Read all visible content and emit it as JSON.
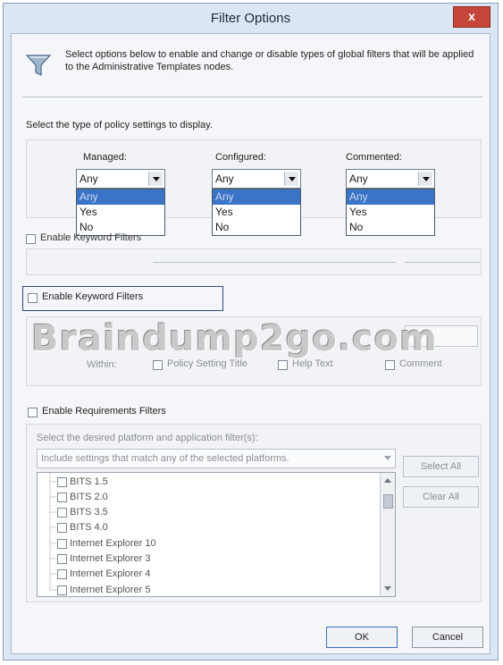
{
  "window": {
    "title": "Filter Options",
    "close_label": "x"
  },
  "description": "Select options below to enable and change or disable types of global filters that will be applied to the Administrative Templates nodes.",
  "policy_type": {
    "heading": "Select the type of policy settings to display.",
    "managed": {
      "label": "Managed:",
      "value": "Any",
      "options": [
        "Any",
        "Yes",
        "No"
      ]
    },
    "configured": {
      "label": "Configured:",
      "value": "Any",
      "options": [
        "Any",
        "Yes",
        "No"
      ]
    },
    "commented": {
      "label": "Commented:",
      "value": "Any",
      "options": [
        "Any",
        "Yes",
        "No"
      ]
    }
  },
  "obscured_checkbox_label": "Enable Keyword Filters",
  "keyword": {
    "checkbox_label": "Enable Keyword Filters",
    "within_label": "Within:",
    "options": [
      "Policy Setting Title",
      "Help Text",
      "Comment"
    ]
  },
  "watermark": "Braindump2go.com",
  "requirements": {
    "checkbox_label": "Enable Requirements Filters",
    "platform_label": "Select the desired platform and application filter(s):",
    "match_value": "Include settings that match any of the selected platforms.",
    "select_all": "Select All",
    "clear_all": "Clear All",
    "platforms": [
      "BITS 1.5",
      "BITS 2.0",
      "BITS 3.5",
      "BITS 4.0",
      "Internet Explorer 10",
      "Internet Explorer 3",
      "Internet Explorer 4",
      "Internet Explorer 5"
    ]
  },
  "footer": {
    "ok": "OK",
    "cancel": "Cancel"
  }
}
